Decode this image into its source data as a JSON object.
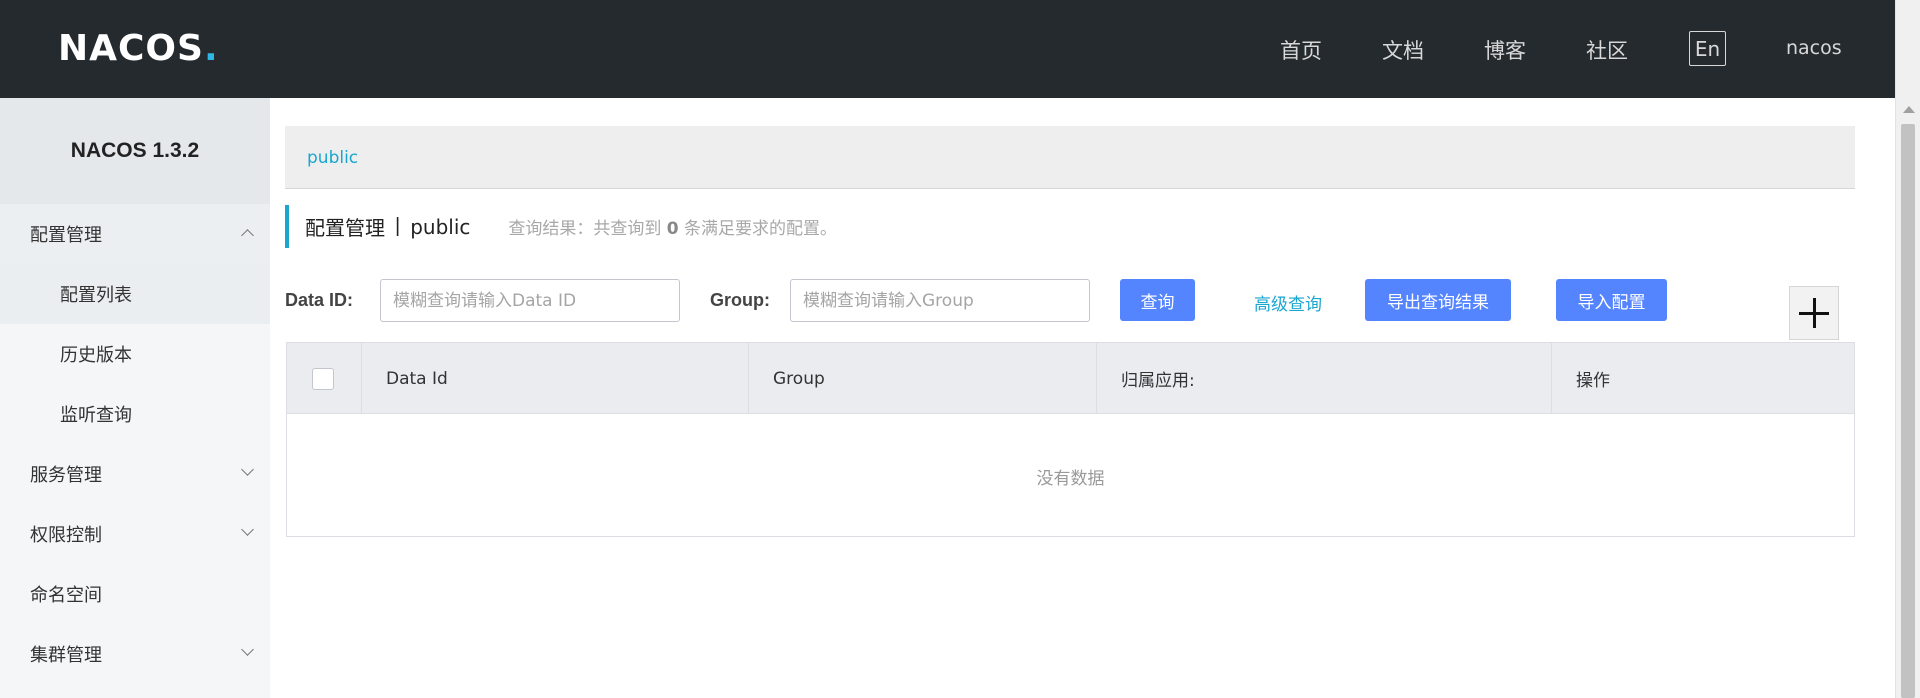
{
  "header": {
    "logo_text": "NACOS",
    "nav": [
      "首页",
      "文档",
      "博客",
      "社区"
    ],
    "lang_button": "En",
    "user": "nacos"
  },
  "sidebar": {
    "title": "NACOS 1.3.2",
    "items": [
      {
        "label": "配置管理",
        "chevron": "up"
      },
      {
        "label": "配置列表"
      },
      {
        "label": "历史版本"
      },
      {
        "label": "监听查询"
      },
      {
        "label": "服务管理",
        "chevron": "down"
      },
      {
        "label": "权限控制",
        "chevron": "down"
      },
      {
        "label": "命名空间"
      },
      {
        "label": "集群管理",
        "chevron": "down"
      }
    ]
  },
  "breadcrumb": {
    "namespace": "public"
  },
  "page": {
    "title": "配置管理",
    "separator": "|",
    "namespace": "public",
    "hint_prefix": "查询结果：共查询到",
    "hint_count": "0",
    "hint_suffix": "条满足要求的配置。"
  },
  "search": {
    "data_id_label": "Data ID:",
    "data_id_placeholder": "模糊查询请输入Data ID",
    "group_label": "Group:",
    "group_placeholder": "模糊查询请输入Group",
    "query_button": "查询",
    "advanced_link": "高级查询",
    "export_button": "导出查询结果",
    "import_button": "导入配置"
  },
  "table": {
    "columns": [
      "Data Id",
      "Group",
      "归属应用:",
      "操作"
    ],
    "empty_text": "没有数据"
  },
  "colors": {
    "header_bg": "#252a2f",
    "accent": "#1aa6cf",
    "primary_button": "#5584ff"
  }
}
